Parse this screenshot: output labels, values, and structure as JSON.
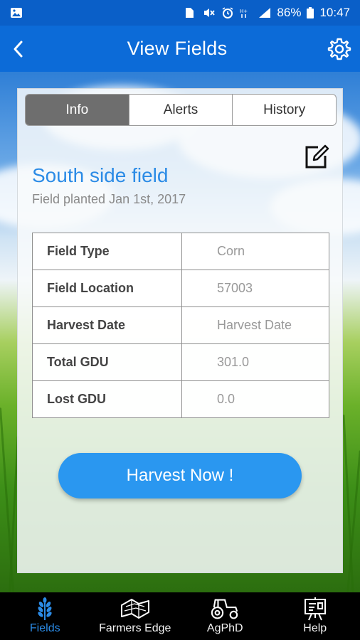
{
  "status_bar": {
    "battery": "86%",
    "time": "10:47"
  },
  "app_bar": {
    "title": "View Fields"
  },
  "tabs": [
    {
      "label": "Info",
      "active": true
    },
    {
      "label": "Alerts",
      "active": false
    },
    {
      "label": "History",
      "active": false
    }
  ],
  "field": {
    "name": "South side field",
    "planted": "Field planted Jan 1st, 2017"
  },
  "details": [
    {
      "key": "Field Type",
      "value": "Corn"
    },
    {
      "key": "Field Location",
      "value": "57003"
    },
    {
      "key": "Harvest Date",
      "value": "Harvest Date"
    },
    {
      "key": "Total GDU",
      "value": "301.0"
    },
    {
      "key": "Lost GDU",
      "value": "0.0"
    }
  ],
  "harvest_button": "Harvest Now !",
  "bottom_nav": [
    {
      "label": "Fields",
      "icon": "wheat-icon",
      "active": true
    },
    {
      "label": "Farmers Edge",
      "icon": "map-icon",
      "active": false
    },
    {
      "label": "AgPhD",
      "icon": "tractor-icon",
      "active": false
    },
    {
      "label": "Help",
      "icon": "presentation-board-icon",
      "active": false
    }
  ],
  "colors": {
    "primary": "#0c6bd8",
    "accent": "#2b8be6",
    "button": "#2a97f0"
  }
}
